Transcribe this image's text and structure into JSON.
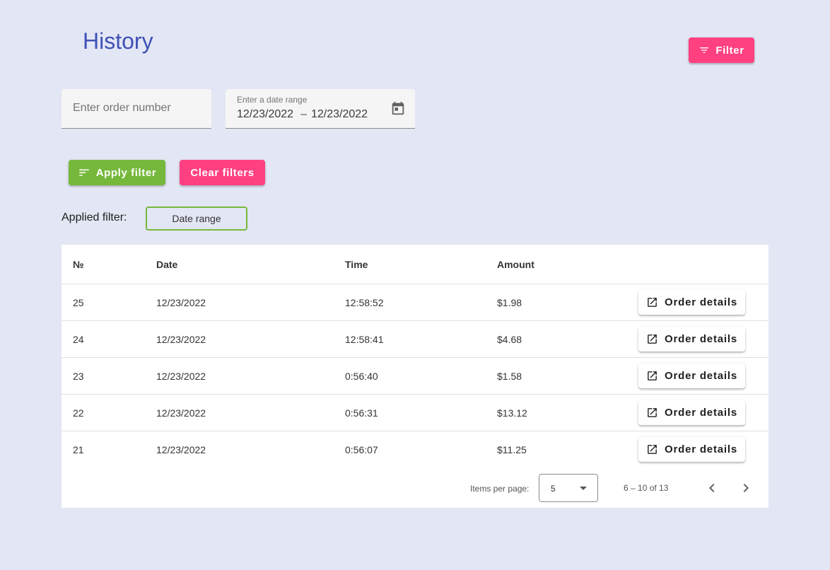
{
  "page": {
    "title": "History"
  },
  "header": {
    "filter_label": "Filter"
  },
  "filters": {
    "order_placeholder": "Enter order number",
    "order_value": "",
    "date_label": "Enter a date range",
    "date_start": "12/23/2022",
    "date_separator": "–",
    "date_end": "12/23/2022"
  },
  "actions": {
    "apply_label": "Apply filter",
    "clear_label": "Clear filters"
  },
  "applied": {
    "label": "Applied filter:",
    "chips": [
      "Date range"
    ]
  },
  "table": {
    "columns": [
      "№",
      "Date",
      "Time",
      "Amount"
    ],
    "details_label": "Order details",
    "rows": [
      {
        "num": "25",
        "date": "12/23/2022",
        "time": "12:58:52",
        "amount": "$1.98"
      },
      {
        "num": "24",
        "date": "12/23/2022",
        "time": "12:58:41",
        "amount": "$4.68"
      },
      {
        "num": "23",
        "date": "12/23/2022",
        "time": "0:56:40",
        "amount": "$1.58"
      },
      {
        "num": "22",
        "date": "12/23/2022",
        "time": "0:56:31",
        "amount": "$13.12"
      },
      {
        "num": "21",
        "date": "12/23/2022",
        "time": "0:56:07",
        "amount": "$11.25"
      }
    ]
  },
  "paginator": {
    "items_label": "Items per page:",
    "page_size": "5",
    "range_label": "6 – 10 of 13"
  },
  "icons": {
    "filter": "filter-list-icon",
    "calendar": "calendar-icon",
    "open_in_new": "open-in-new-icon",
    "prev": "chevron-left-icon",
    "next": "chevron-right-icon"
  },
  "colors": {
    "background": "#e3e6f4",
    "primary": "#3f51b5",
    "accent": "#ff4081",
    "success": "#76b83b"
  }
}
